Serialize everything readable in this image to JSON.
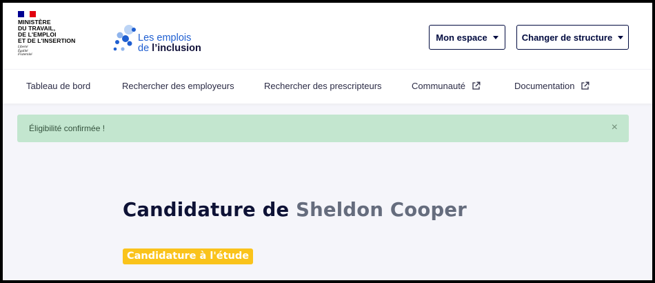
{
  "header": {
    "ministry_lines": [
      "MINISTÈRE",
      "DU TRAVAIL,",
      "DE L'EMPLOI",
      "ET DE L'INSERTION"
    ],
    "motto_lines": [
      "Liberté",
      "Égalité",
      "Fraternité"
    ],
    "logo": {
      "line1": "Les emplois",
      "line2_prefix": "de ",
      "line2_bold": "l’inclusion"
    },
    "mon_espace_label": "Mon espace",
    "changer_structure_label": "Changer de structure"
  },
  "nav": {
    "items": [
      {
        "label": "Tableau de bord",
        "external": false
      },
      {
        "label": "Rechercher des employeurs",
        "external": false
      },
      {
        "label": "Rechercher des prescripteurs",
        "external": false
      },
      {
        "label": "Communauté",
        "external": true
      },
      {
        "label": "Documentation",
        "external": true
      }
    ]
  },
  "alert": {
    "message": "Éligibilité confirmée !",
    "close_symbol": "×"
  },
  "main": {
    "title_prefix": "Candidature de ",
    "candidate_name": "Sheldon Cooper",
    "status_badge": "Candidature à l'étude"
  },
  "colors": {
    "accent_blue": "#1f5fd1",
    "navy": "#000a3f",
    "alert_bg": "#c3e6cf",
    "badge_bg": "#fac31b",
    "flag_blue": "#000091",
    "flag_red": "#e1000f"
  },
  "icons": {
    "external_link": "external-link-icon",
    "close": "close-icon",
    "caret": "caret-down-icon"
  }
}
